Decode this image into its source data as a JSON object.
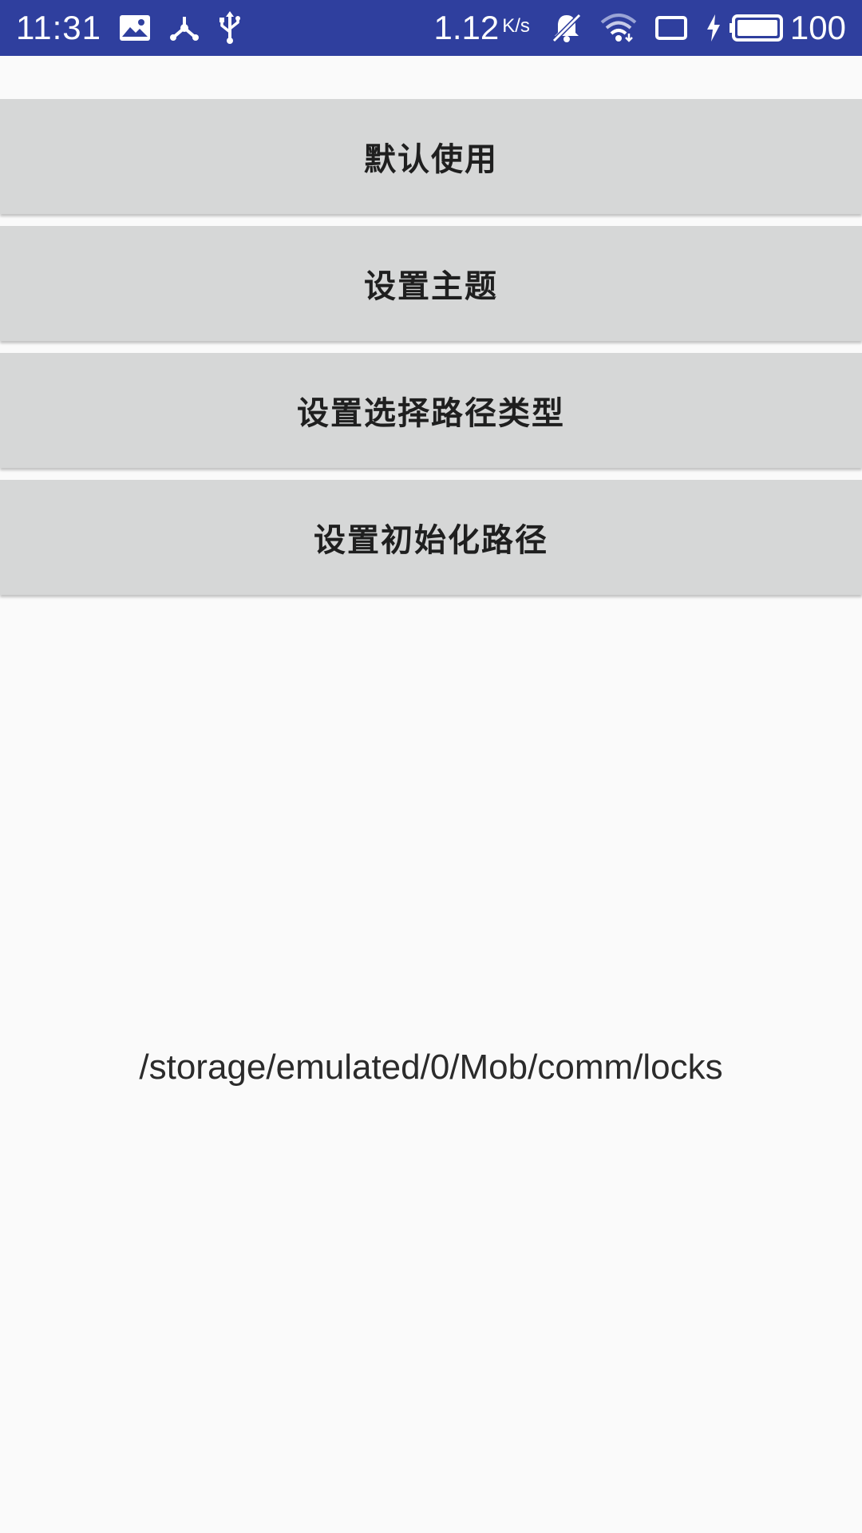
{
  "status_bar": {
    "time": "11:31",
    "net_speed": "1.12",
    "net_unit": "K/s",
    "battery_level": "100",
    "icons": [
      "image-icon",
      "share-hub-icon",
      "usb-icon",
      "bell-off-icon",
      "wifi-icon",
      "tablet-icon",
      "charging-bolt-icon",
      "battery-icon"
    ],
    "background_color": "#2f3f9e"
  },
  "buttons": [
    {
      "label": "默认使用"
    },
    {
      "label": "设置主题"
    },
    {
      "label": "设置选择路径类型"
    },
    {
      "label": "设置初始化路径"
    }
  ],
  "path_display": "/storage/emulated/0/Mob/comm/locks",
  "colors": {
    "button_bg": "#d6d7d7",
    "page_bg": "#fafafa",
    "text": "#1f1f1f"
  }
}
